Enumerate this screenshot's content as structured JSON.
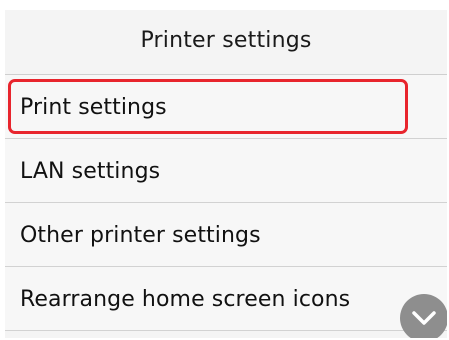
{
  "header": {
    "title": "Printer settings"
  },
  "menu": {
    "items": [
      {
        "label": "Print settings",
        "selected": true
      },
      {
        "label": "LAN settings",
        "selected": false
      },
      {
        "label": "Other printer settings",
        "selected": false
      },
      {
        "label": "Rearrange home screen icons",
        "selected": false
      }
    ]
  },
  "scroll": {
    "icon": "chevron-down-icon"
  },
  "colors": {
    "selection": "#e8252d",
    "scroll_button": "#8e8e8e"
  }
}
